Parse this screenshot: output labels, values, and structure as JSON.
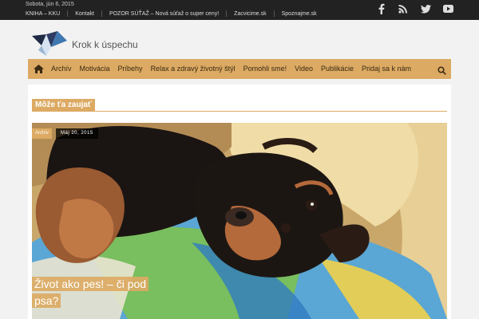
{
  "topbar": {
    "date": "Sobota, jún 6, 2015",
    "links": [
      "KNIHA – KKU",
      "Kontakt",
      "POZOR SÚŤAŽ – Nová súťaž o super ceny!",
      "Zacvicime.sk",
      "Spoznajme.sk"
    ],
    "social": [
      "facebook-icon",
      "rss-icon",
      "twitter-icon",
      "youtube-icon"
    ]
  },
  "header": {
    "site_name": "Krok k úspechu"
  },
  "nav": {
    "items": [
      "Archív",
      "Motivácia",
      "Príbehy",
      "Relax a zdravý životný štýl",
      "Pomohli sme!",
      "Video",
      "Publikácie",
      "Pridaj sa k nám"
    ]
  },
  "section": {
    "title": "Môže ťa zaujať"
  },
  "featured": {
    "category": "Archív",
    "date": "Máj 20, 2015",
    "title": "Život ako pes! – či pod psa?"
  },
  "colors": {
    "accent": "#dcaa63",
    "topbar": "#222222"
  }
}
